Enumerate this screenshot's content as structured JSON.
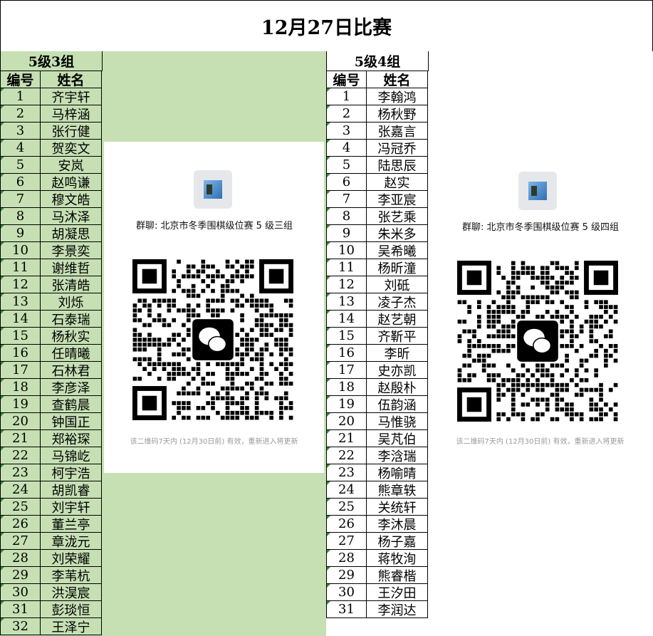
{
  "title": "12月27日比赛",
  "group_left": {
    "title": "5级3组",
    "col_num": "编号",
    "col_name": "姓名",
    "rows": [
      [
        "1",
        "齐宇轩"
      ],
      [
        "2",
        "马梓涵"
      ],
      [
        "3",
        "张行健"
      ],
      [
        "4",
        "贺奕文"
      ],
      [
        "5",
        "安岚"
      ],
      [
        "6",
        "赵鸣谦"
      ],
      [
        "7",
        "穆文皓"
      ],
      [
        "8",
        "马沐泽"
      ],
      [
        "9",
        "胡凝思"
      ],
      [
        "10",
        "李景奕"
      ],
      [
        "11",
        "谢维哲"
      ],
      [
        "12",
        "张清皓"
      ],
      [
        "13",
        "刘烁"
      ],
      [
        "14",
        "石泰瑞"
      ],
      [
        "15",
        "杨秋实"
      ],
      [
        "16",
        "任晴曦"
      ],
      [
        "17",
        "石林君"
      ],
      [
        "18",
        "李彦泽"
      ],
      [
        "19",
        "查鹤晨"
      ],
      [
        "20",
        "钟国正"
      ],
      [
        "21",
        "郑裕琛"
      ],
      [
        "22",
        "马锦屹"
      ],
      [
        "23",
        "柯宇浩"
      ],
      [
        "24",
        "胡凯睿"
      ],
      [
        "25",
        "刘宇轩"
      ],
      [
        "26",
        "董兰亭"
      ],
      [
        "27",
        "章泷元"
      ],
      [
        "28",
        "刘荣耀"
      ],
      [
        "29",
        "李苇杭"
      ],
      [
        "30",
        "洪淏宸"
      ],
      [
        "31",
        "彭琰恒"
      ],
      [
        "32",
        "王泽宁"
      ]
    ]
  },
  "group_right": {
    "title": "5级4组",
    "col_num": "编号",
    "col_name": "姓名",
    "rows": [
      [
        "1",
        "李翰鸿"
      ],
      [
        "2",
        "杨秋野"
      ],
      [
        "3",
        "张嘉言"
      ],
      [
        "4",
        "冯冠乔"
      ],
      [
        "5",
        "陆思辰"
      ],
      [
        "6",
        "赵实"
      ],
      [
        "7",
        "李亚宸"
      ],
      [
        "8",
        "张艺乘"
      ],
      [
        "9",
        "朱米多"
      ],
      [
        "10",
        "吴希曦"
      ],
      [
        "11",
        "杨昕潼"
      ],
      [
        "12",
        "刘砥"
      ],
      [
        "13",
        "凌子杰"
      ],
      [
        "14",
        "赵艺朝"
      ],
      [
        "15",
        "齐靳平"
      ],
      [
        "16",
        "李昕"
      ],
      [
        "17",
        "史亦凯"
      ],
      [
        "18",
        "赵殷朴"
      ],
      [
        "19",
        "伍韵涵"
      ],
      [
        "20",
        "马惟骁"
      ],
      [
        "21",
        "吴芃伯"
      ],
      [
        "22",
        "李浛瑞"
      ],
      [
        "23",
        "杨喻晴"
      ],
      [
        "24",
        "熊章轶"
      ],
      [
        "25",
        "关统轩"
      ],
      [
        "26",
        "李沐晨"
      ],
      [
        "27",
        "杨子嘉"
      ],
      [
        "28",
        "蒋牧洵"
      ],
      [
        "29",
        "熊睿楷"
      ],
      [
        "30",
        "王汐田"
      ],
      [
        "31",
        "李润达"
      ]
    ]
  },
  "qr_left": {
    "name": "群聊: 北京市冬季围棋级位赛 5 级三组",
    "note": "该二维码7天内 (12月30日前) 有效，重新进入将更新",
    "icon": "wechat-icon"
  },
  "qr_right": {
    "name": "群聊: 北京市冬季围棋级位赛 5 级四组",
    "note": "该二维码7天内 (12月30日前) 有效，重新进入将更新",
    "icon": "wechat-icon"
  },
  "colors": {
    "green": "#c6e0b4",
    "border": "#000000"
  }
}
